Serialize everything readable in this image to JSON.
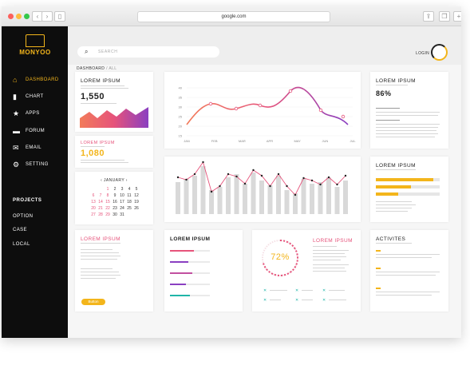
{
  "browser": {
    "url": "google.com"
  },
  "sidebar": {
    "brand": "MONYOO",
    "items": [
      {
        "label": "DASHBOARD",
        "icon": "home-icon"
      },
      {
        "label": "CHART",
        "icon": "chart-icon"
      },
      {
        "label": "APPS",
        "icon": "star-icon"
      },
      {
        "label": "FORUM",
        "icon": "chat-icon"
      },
      {
        "label": "EMAIL",
        "icon": "mail-icon"
      },
      {
        "label": "SETTING",
        "icon": "gear-icon"
      }
    ],
    "projects_title": "PROJECTS",
    "projects": [
      "OPTION",
      "CASE",
      "LOCAL"
    ]
  },
  "header": {
    "search_placeholder": "SEARCH",
    "login_label": "LOGIN"
  },
  "breadcrumb": {
    "main": "DASHBOARD",
    "sub": "/ ALL"
  },
  "cards": {
    "area_stat": {
      "title": "LOREM IPSUM",
      "value": "1,550"
    },
    "stat2": {
      "title": "LOREM IPSUM",
      "value": "1,080"
    },
    "percent_card": {
      "title": "LOREM IPSUM",
      "value": "86%"
    },
    "bars_card": {
      "title": "LOREM IPSUM"
    },
    "info_card": {
      "title": "LOREM IPSUM",
      "button": "Button"
    },
    "progress_card": {
      "title": "LOREM IPSUM"
    },
    "donut_card": {
      "title": "LOREM IPSUM",
      "value": "72%"
    },
    "activities": {
      "title": "ACTIVITES"
    }
  },
  "calendar": {
    "month": "JANUARY",
    "days": [
      [
        "",
        "",
        "1",
        "2",
        "3",
        "4",
        "5"
      ],
      [
        "6",
        "7",
        "8",
        "9",
        "10",
        "11",
        "12"
      ],
      [
        "13",
        "14",
        "15",
        "16",
        "17",
        "18",
        "19"
      ],
      [
        "20",
        "21",
        "22",
        "23",
        "24",
        "25",
        "26"
      ],
      [
        "27",
        "28",
        "29",
        "30",
        "31",
        "",
        ""
      ]
    ]
  },
  "line_chart": {
    "x_labels": [
      "JAN",
      "FEB",
      "MAR",
      "APR",
      "MAY",
      "JUN",
      "JUL"
    ],
    "y_labels": [
      "40",
      "35",
      "30",
      "25",
      "20",
      "15"
    ]
  },
  "colors": {
    "accent": "#f3b51b",
    "pink": "#e6537b",
    "purple": "#8a3fc1",
    "teal": "#1fb5a8",
    "sidebar": "#0d0d0d"
  }
}
